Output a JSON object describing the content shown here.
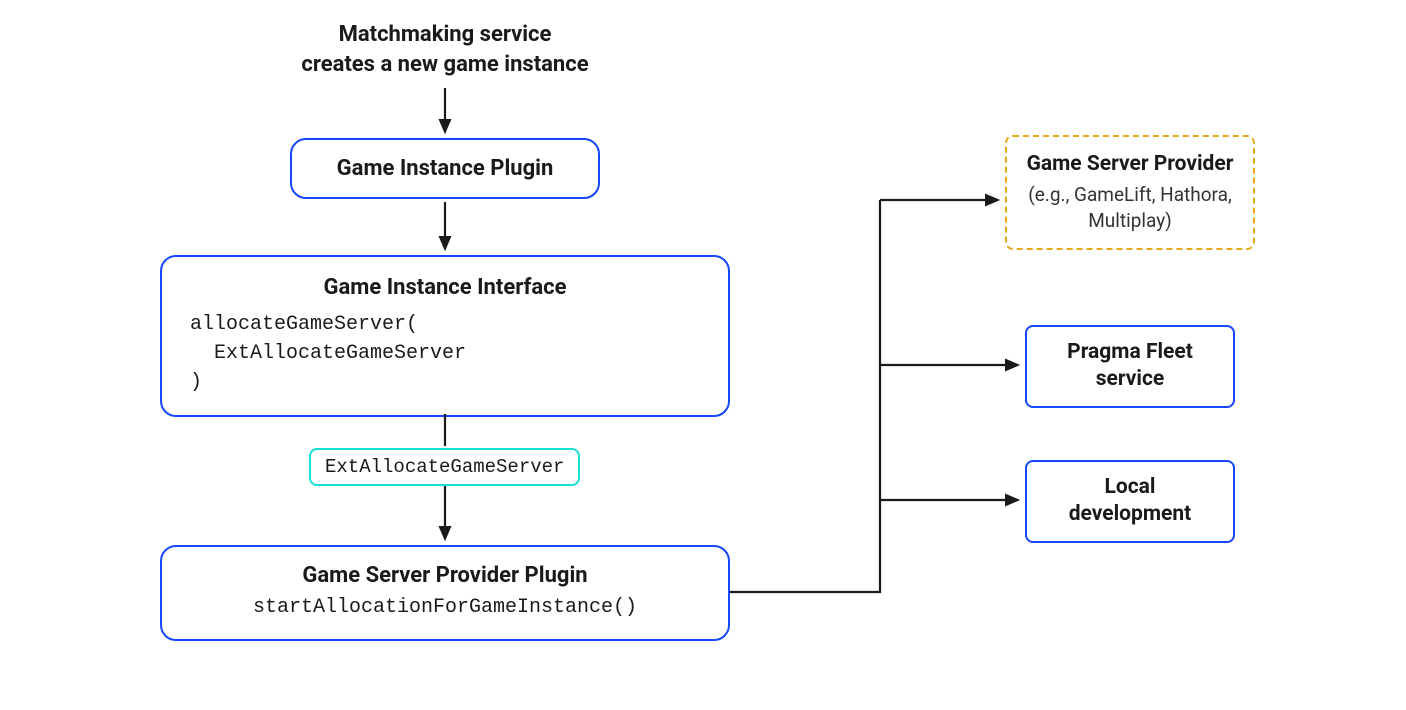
{
  "diagram": {
    "header_line1": "Matchmaking service",
    "header_line2": "creates a new game instance",
    "plugin_box": "Game Instance Plugin",
    "interface_box": {
      "title": "Game Instance Interface",
      "code_line1": "allocateGameServer(",
      "code_line2": "  ExtAllocateGameServer",
      "code_line3": ")"
    },
    "ext_label": "ExtAllocateGameServer",
    "provider_plugin": {
      "title": "Game Server Provider Plugin",
      "code": "startAllocationForGameInstance()"
    },
    "targets": {
      "provider": {
        "title": "Game Server Provider",
        "sub": "(e.g., GameLift, Hathora, Multiplay)"
      },
      "fleet": {
        "line1": "Pragma Fleet",
        "line2": "service"
      },
      "local": {
        "line1": "Local",
        "line2": "development"
      }
    }
  }
}
